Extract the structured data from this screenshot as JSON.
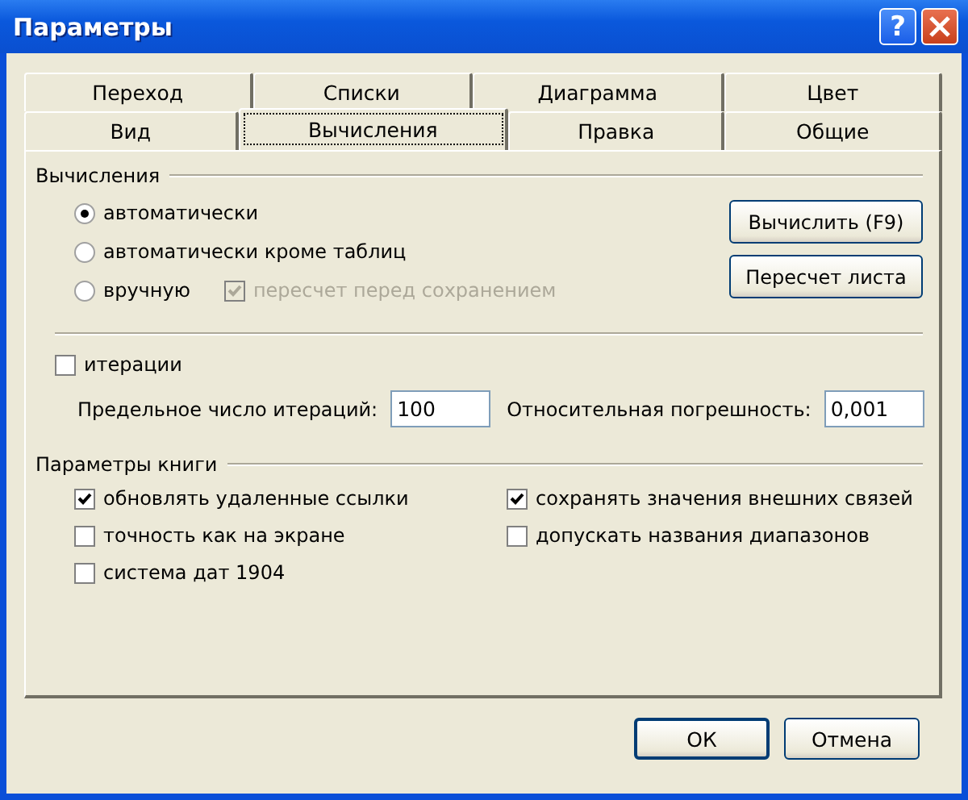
{
  "window": {
    "title": "Параметры",
    "help_glyph": "?"
  },
  "tab_rows": [
    [
      {
        "label": "Переход",
        "selected": false
      },
      {
        "label": "Списки",
        "selected": false
      },
      {
        "label": "Диаграмма",
        "selected": false
      },
      {
        "label": "Цвет",
        "selected": false
      }
    ],
    [
      {
        "label": "Вид",
        "selected": false
      },
      {
        "label": "Вычисления",
        "selected": true
      },
      {
        "label": "Правка",
        "selected": false
      },
      {
        "label": "Общие",
        "selected": false
      }
    ]
  ],
  "calculation": {
    "title": "Вычисления",
    "modes": [
      {
        "label": "автоматически",
        "selected": true
      },
      {
        "label": "автоматически кроме таблиц",
        "selected": false
      },
      {
        "label": "вручную",
        "selected": false
      }
    ],
    "recalc_before_save": {
      "label": "пересчет перед сохранением",
      "checked": true,
      "disabled": true
    },
    "buttons": [
      "Вычислить (F9)",
      "Пересчет листа"
    ]
  },
  "iterations": {
    "label": "итерации",
    "checked": false,
    "fields": [
      {
        "label": "Предельное число итераций:",
        "value": "100"
      },
      {
        "label": "Относительная погрешность:",
        "value": "0,001"
      }
    ]
  },
  "workbook": {
    "title": "Параметры книги",
    "left": [
      {
        "label": "обновлять удаленные ссылки",
        "checked": true
      },
      {
        "label": "точность как на экране",
        "checked": false
      },
      {
        "label": "система дат 1904",
        "checked": false
      }
    ],
    "right": [
      {
        "label": "сохранять значения внешних связей",
        "checked": true
      },
      {
        "label": "допускать названия диапазонов",
        "checked": false
      }
    ]
  },
  "buttons": [
    {
      "label": "ОК",
      "default": true
    },
    {
      "label": "Отмена",
      "default": false
    }
  ]
}
